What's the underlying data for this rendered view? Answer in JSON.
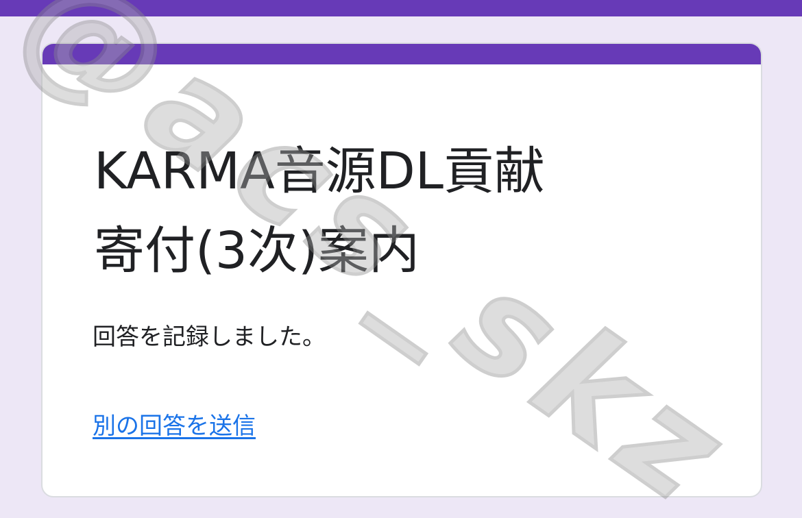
{
  "form": {
    "title": "KARMA音源DL貢献\n寄付(3次)案内",
    "confirmation_message": "回答を記録しました。",
    "submit_another_label": "別の回答を送信"
  },
  "watermark": {
    "text": "@acs_skz"
  },
  "colors": {
    "theme_purple": "#673ab7",
    "page_background": "#ede7f6",
    "link_blue": "#1a73e8",
    "text": "#202124"
  }
}
